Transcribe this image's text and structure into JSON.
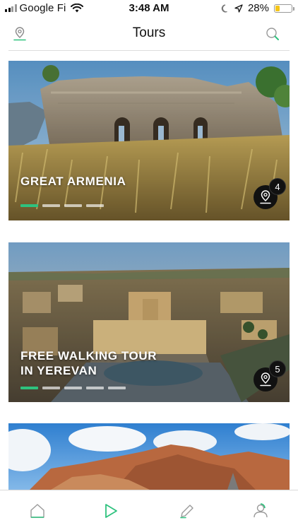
{
  "status_bar": {
    "carrier": "Google Fi",
    "time": "3:48 AM",
    "battery_percent": "28%",
    "battery_level": 0.28,
    "icons": [
      "signal-icon",
      "wifi-icon",
      "moon-icon",
      "location-arrow-icon",
      "battery-icon"
    ]
  },
  "header": {
    "title": "Tours",
    "left_icon": "map-pin-icon",
    "right_icon": "search-icon"
  },
  "colors": {
    "accent": "#2ec27e",
    "badge_bg": "#111111",
    "battery": "#f5c518"
  },
  "tours": [
    {
      "title": "GREAT ARMENIA",
      "stops": "4",
      "page_count": 4,
      "active_page": 0
    },
    {
      "title": "FREE WALKING TOUR\nIN YEREVAN",
      "stops": "5",
      "page_count": 5,
      "active_page": 0
    },
    {
      "title": "",
      "stops": "",
      "page_count": 0,
      "active_page": 0
    }
  ],
  "tab_bar": {
    "tabs": [
      {
        "icon": "home-icon",
        "active": false
      },
      {
        "icon": "play-icon",
        "active": true
      },
      {
        "icon": "pencil-icon",
        "active": false
      },
      {
        "icon": "user-icon",
        "active": false
      }
    ]
  }
}
